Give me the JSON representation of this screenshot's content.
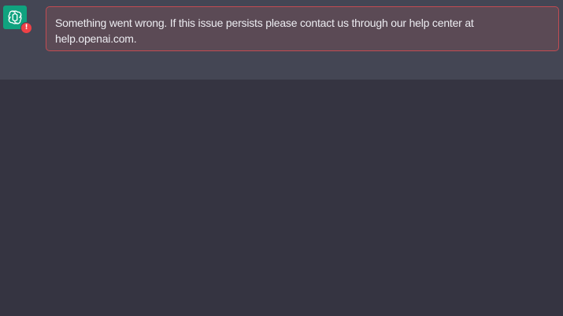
{
  "conversation": {
    "assistant_avatar_icon": "openai-logo-icon",
    "assistant_avatar_color": "#10a37f",
    "error_badge": {
      "icon": "exclamation-icon",
      "symbol": "!",
      "color": "#ef4146"
    },
    "error_message": {
      "text": "Something went wrong. If this issue persists please contact us through our help center at help.openai.com.",
      "border_color": "#c24b52",
      "background_color": "#5b4a55"
    }
  },
  "theme": {
    "page_background": "#353441",
    "message_background": "#444654",
    "text_color": "#ececf1"
  }
}
